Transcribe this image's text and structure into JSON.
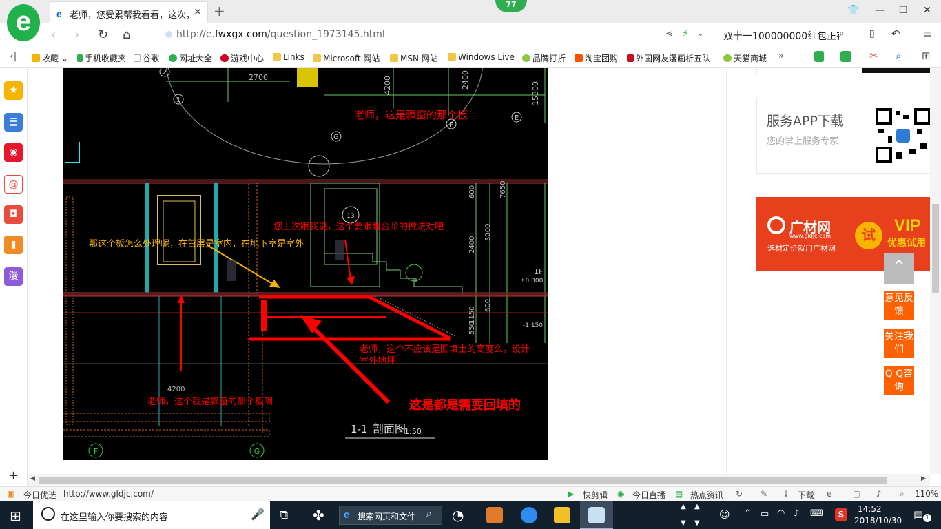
{
  "browser": {
    "tab_title": "老师，您受累帮我看看，这次，七",
    "notification_count": "77",
    "url_prefix": "http://e.",
    "url_domain": "fwxgx.com",
    "url_path": "/question_1973145.html",
    "search_text": "双十一100000000红包正在",
    "logo_letter": "e"
  },
  "bookmarks": [
    {
      "label": "收藏",
      "icon": "star-icon",
      "color": "#f4b400"
    },
    {
      "label": "手机收藏夹",
      "icon": "phone-icon",
      "color": "#2eae4f"
    },
    {
      "label": "谷歌",
      "icon": "page-icon",
      "color": "#aaaaaa"
    },
    {
      "label": "网址大全",
      "icon": "globe-icon",
      "color": "#2eae4f"
    },
    {
      "label": "游戏中心",
      "icon": "game-icon",
      "color": "#d0021b"
    },
    {
      "label": "Links",
      "icon": "folder-icon",
      "color": "#f1c74a"
    },
    {
      "label": "Microsoft 网站",
      "icon": "folder-icon",
      "color": "#f1c74a"
    },
    {
      "label": "MSN 网站",
      "icon": "folder-icon",
      "color": "#f1c74a"
    },
    {
      "label": "Windows Live",
      "icon": "folder-icon",
      "color": "#f1c74a"
    },
    {
      "label": "品牌打折",
      "icon": "leaf-icon",
      "color": "#8dc63f"
    },
    {
      "label": "淘宝团购",
      "icon": "taobao-icon",
      "color": "#ff5000"
    },
    {
      "label": "外国网友漫画析五队",
      "icon": "bookmark-icon",
      "color": "#c1121f"
    },
    {
      "label": "天猫商城",
      "icon": "leaf-icon",
      "color": "#8dc63f"
    }
  ],
  "cad": {
    "dims": [
      "2700",
      "4200",
      "2400",
      "15300",
      "600",
      "7650",
      "2400",
      "3000",
      "600",
      "1150",
      "550",
      "4200"
    ],
    "grid_labels": [
      "1",
      "2",
      "G",
      "F",
      "E",
      "13",
      "E1",
      "F",
      "G"
    ],
    "level_1f": "1F",
    "level_pos": "±0.000",
    "level_neg": "-1.150",
    "section_title": "1-1",
    "section_name": "剖面图",
    "section_scale": "1:50",
    "notes": {
      "bay_board": "老师，这是飘窗的那个板",
      "board_question": "那这个板怎么处理呢，在首层是室内，在地下室是室外",
      "steps": "您上次跟我说，这个要跟着台阶的做法对吧",
      "backfill_q1": "老师，这个不应该是回填土的高度么，设计",
      "backfill_q2": "室外地坪",
      "bay_board_2": "老师，这个就是飘窗的那个板啊",
      "backfill_all": "这是都是需要回填的"
    }
  },
  "rightcol": {
    "app_title": "服务APP下载",
    "app_sub": "您的掌上服务专家",
    "ad_brand": "广材网",
    "ad_site": "www.gldjc.com",
    "ad_slogan": "选材定价就用广材网",
    "ad_try": "试",
    "ad_vip": "VIP",
    "ad_vip_sub": "优惠试用"
  },
  "float_buttons": {
    "feedback": "意见反馈",
    "follow": "关注我们",
    "qq": "Q Q咨询"
  },
  "status": {
    "today": "今日优选",
    "link": "http://www.gldjc.com/",
    "clip": "快剪辑",
    "live": "今日直播",
    "news": "热点资讯",
    "download": "下载",
    "zoom": "110%"
  },
  "taskbar": {
    "search_placeholder": "在这里输入你要搜索的内容",
    "web_search": "搜索网页和文件",
    "time": "14:52",
    "date": "2018/10/30",
    "notifications": "1"
  },
  "sidebar": [
    {
      "name": "favorites-icon",
      "color": "#f4b400",
      "glyph": "★"
    },
    {
      "name": "feed-icon",
      "color": "#3b7dd8",
      "glyph": "▤"
    },
    {
      "name": "weibo-icon",
      "color": "#e6162d",
      "glyph": "◉"
    },
    {
      "name": "mail-icon",
      "color": "#e84c3d",
      "glyph": "@"
    },
    {
      "name": "game-icon",
      "color": "#e84c3d",
      "glyph": "◘"
    },
    {
      "name": "book-icon",
      "color": "#f08a24",
      "glyph": "▮"
    },
    {
      "name": "comic-icon",
      "color": "#8e5cd9",
      "glyph": "漫"
    }
  ]
}
